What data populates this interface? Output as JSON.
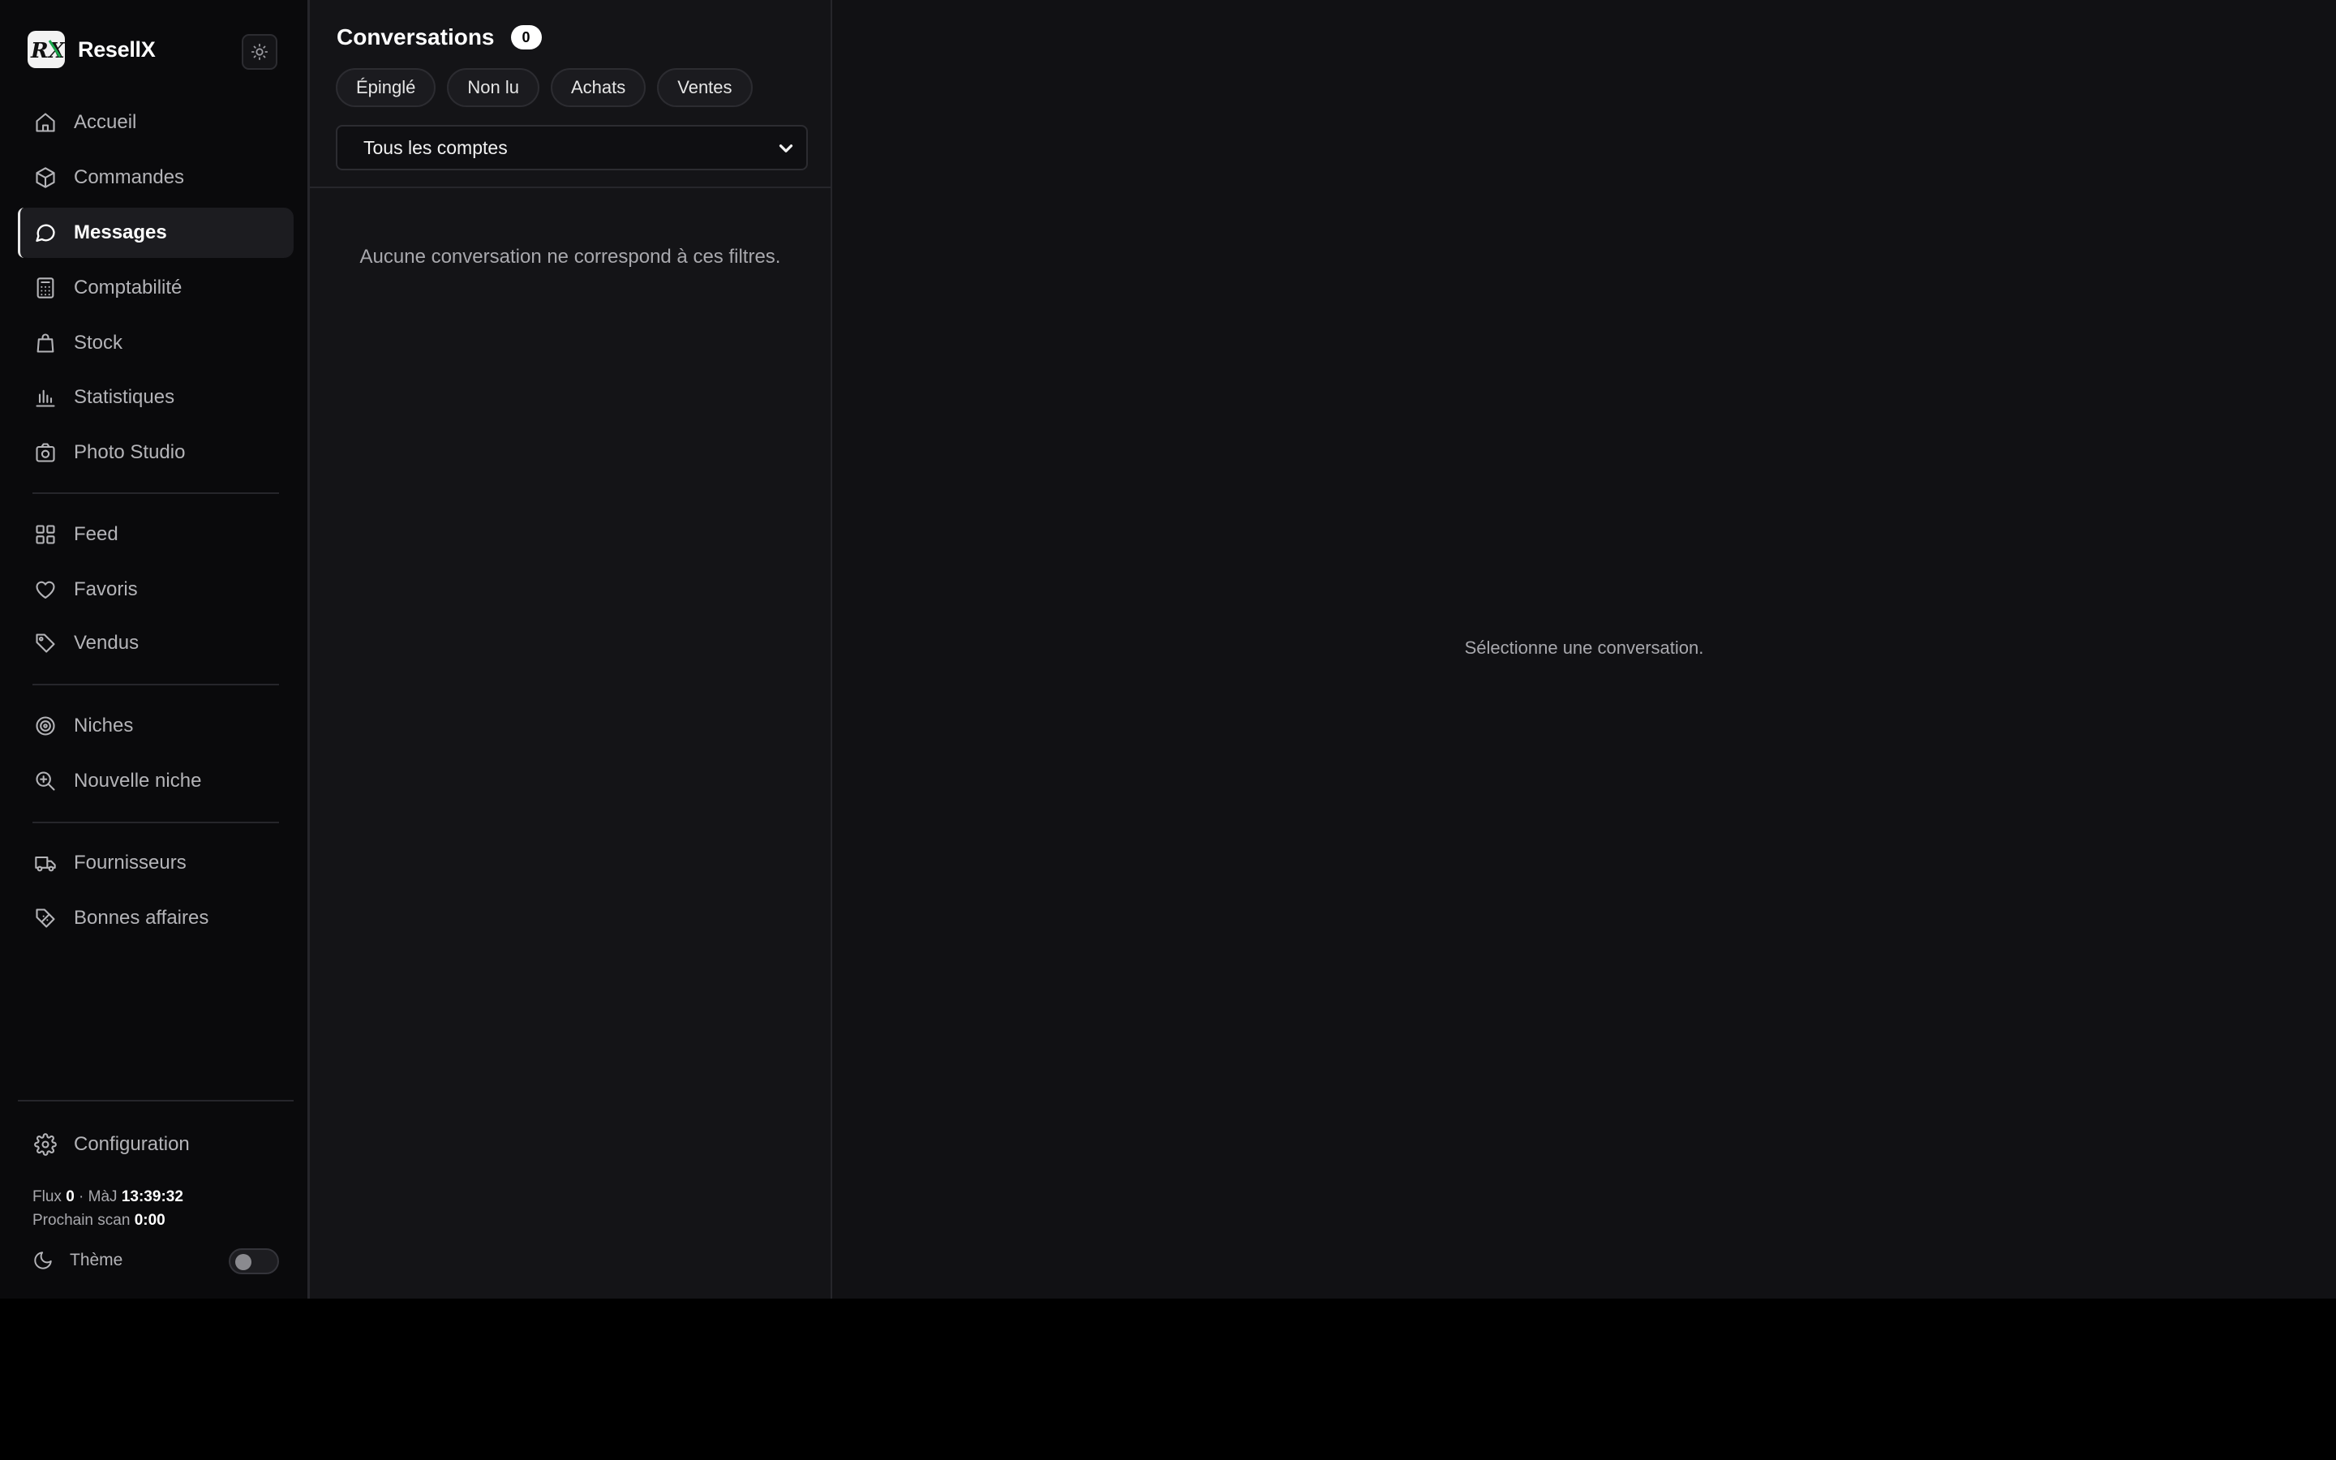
{
  "brand": {
    "name": "ResellX",
    "logo_text": "RX",
    "logo_icon": "resellx-logo-icon",
    "collapse_icon": "sun-icon"
  },
  "sidebar": {
    "items": [
      {
        "label": "Accueil",
        "icon": "home-icon"
      },
      {
        "label": "Commandes",
        "icon": "package-icon"
      },
      {
        "label": "Messages",
        "icon": "message-circle-icon",
        "active": true
      },
      {
        "label": "Comptabilité",
        "icon": "calculator-icon"
      },
      {
        "label": "Stock",
        "icon": "shopping-bag-icon"
      },
      {
        "label": "Statistiques",
        "icon": "bar-chart-icon"
      },
      {
        "label": "Photo Studio",
        "icon": "camera-icon"
      },
      {
        "label": "Feed",
        "icon": "grid-icon"
      },
      {
        "label": "Favoris",
        "icon": "heart-icon"
      },
      {
        "label": "Vendus",
        "icon": "tag-icon"
      },
      {
        "label": "Niches",
        "icon": "target-icon"
      },
      {
        "label": "Nouvelle niche",
        "icon": "search-plus-icon"
      },
      {
        "label": "Fournisseurs",
        "icon": "truck-icon"
      },
      {
        "label": "Bonnes affaires",
        "icon": "discount-tag-icon"
      }
    ],
    "footer": {
      "config_label": "Configuration",
      "flux_label": "Flux",
      "flux_value": "0",
      "separator": "·",
      "maj_label": "MàJ",
      "maj_value": "13:39:32",
      "scan_label": "Prochain scan",
      "scan_value": "0:00",
      "theme_label": "Thème",
      "theme_on": false
    }
  },
  "conversations": {
    "title": "Conversations",
    "count": "0",
    "filters": [
      "Épinglé",
      "Non lu",
      "Achats",
      "Ventes"
    ],
    "account_select": "Tous les comptes",
    "empty_text": "Aucune conversation ne correspond à ces filtres."
  },
  "detail": {
    "empty_text": "Sélectionne une conversation."
  },
  "colors": {
    "background": "#111114",
    "sidebar": "#0a0a0c",
    "accent": "#ffffff",
    "muted_text": "#a8a8ad"
  }
}
